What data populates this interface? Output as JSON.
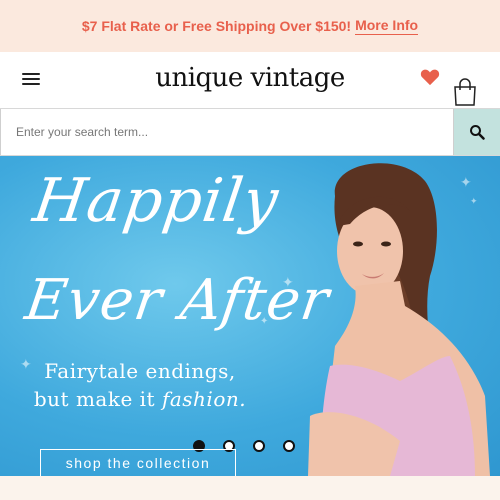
{
  "promo": {
    "text": "$7 Flat Rate or Free Shipping Over $150!",
    "link": "More Info"
  },
  "header": {
    "logo": "unique vintage"
  },
  "search": {
    "placeholder": "Enter your search term..."
  },
  "hero": {
    "headline_line1": "Happily",
    "headline_line2": "Ever After",
    "tagline_line1": "Fairytale endings,",
    "tagline_line2_a": "but make it",
    "tagline_line2_b": "fashion.",
    "cta": "shop the collection",
    "slides": 4,
    "active_slide": 1
  },
  "colors": {
    "accent": "#e8604c",
    "promo_bg": "#fbe9de",
    "hero_bg": "#3fa9dd",
    "search_button": "#c3e2de"
  },
  "icons": [
    "menu-icon",
    "heart-icon",
    "shopping-bag-icon",
    "search-icon"
  ]
}
